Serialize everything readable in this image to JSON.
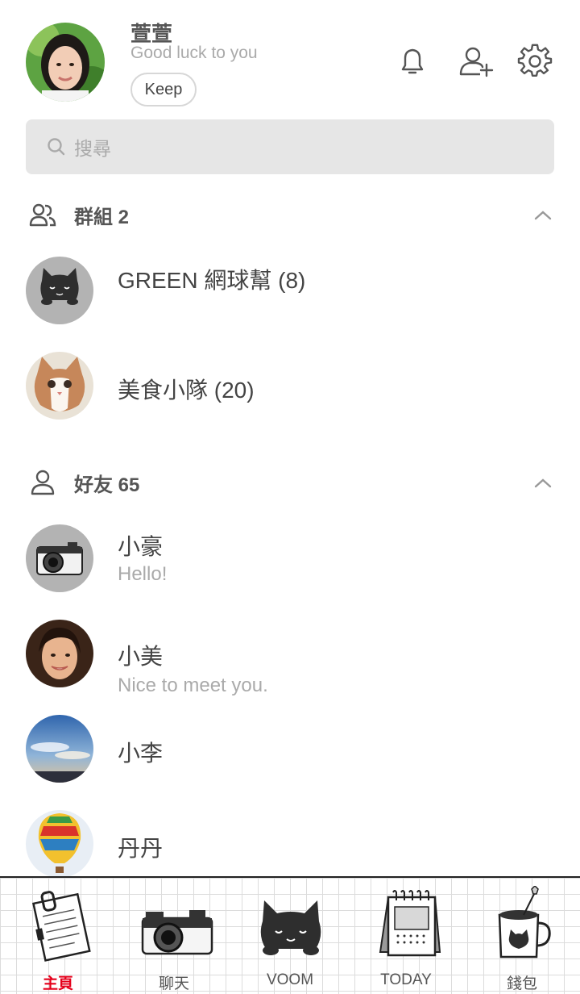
{
  "profile": {
    "name": "萱萱",
    "status": "Good luck to you",
    "keep_label": "Keep"
  },
  "header_icons": [
    "bell-icon",
    "add-friend-icon",
    "gear-icon"
  ],
  "search": {
    "placeholder": "搜尋"
  },
  "groups": {
    "title": "群組 2",
    "items": [
      {
        "name": "GREEN 網球幫 (8)",
        "avatar": "black-cat"
      },
      {
        "name": "美食小隊 (20)",
        "avatar": "kitten-photo"
      }
    ]
  },
  "friends": {
    "title": "好友 65",
    "items": [
      {
        "name": "小豪",
        "status": "Hello!",
        "avatar": "camera"
      },
      {
        "name": "小美",
        "status": "Nice to meet you.",
        "avatar": "woman-photo"
      },
      {
        "name": "小李",
        "status": "",
        "avatar": "sky-photo"
      },
      {
        "name": "丹丹",
        "status": "",
        "avatar": "balloon-photo"
      }
    ]
  },
  "tabs": [
    {
      "label": "主頁",
      "active": true
    },
    {
      "label": "聊天",
      "active": false
    },
    {
      "label": "VOOM",
      "active": false
    },
    {
      "label": "TODAY",
      "active": false
    },
    {
      "label": "錢包",
      "active": false
    }
  ],
  "colors": {
    "active_tab": "#e5001b",
    "search_bg": "#e6e6e6"
  }
}
